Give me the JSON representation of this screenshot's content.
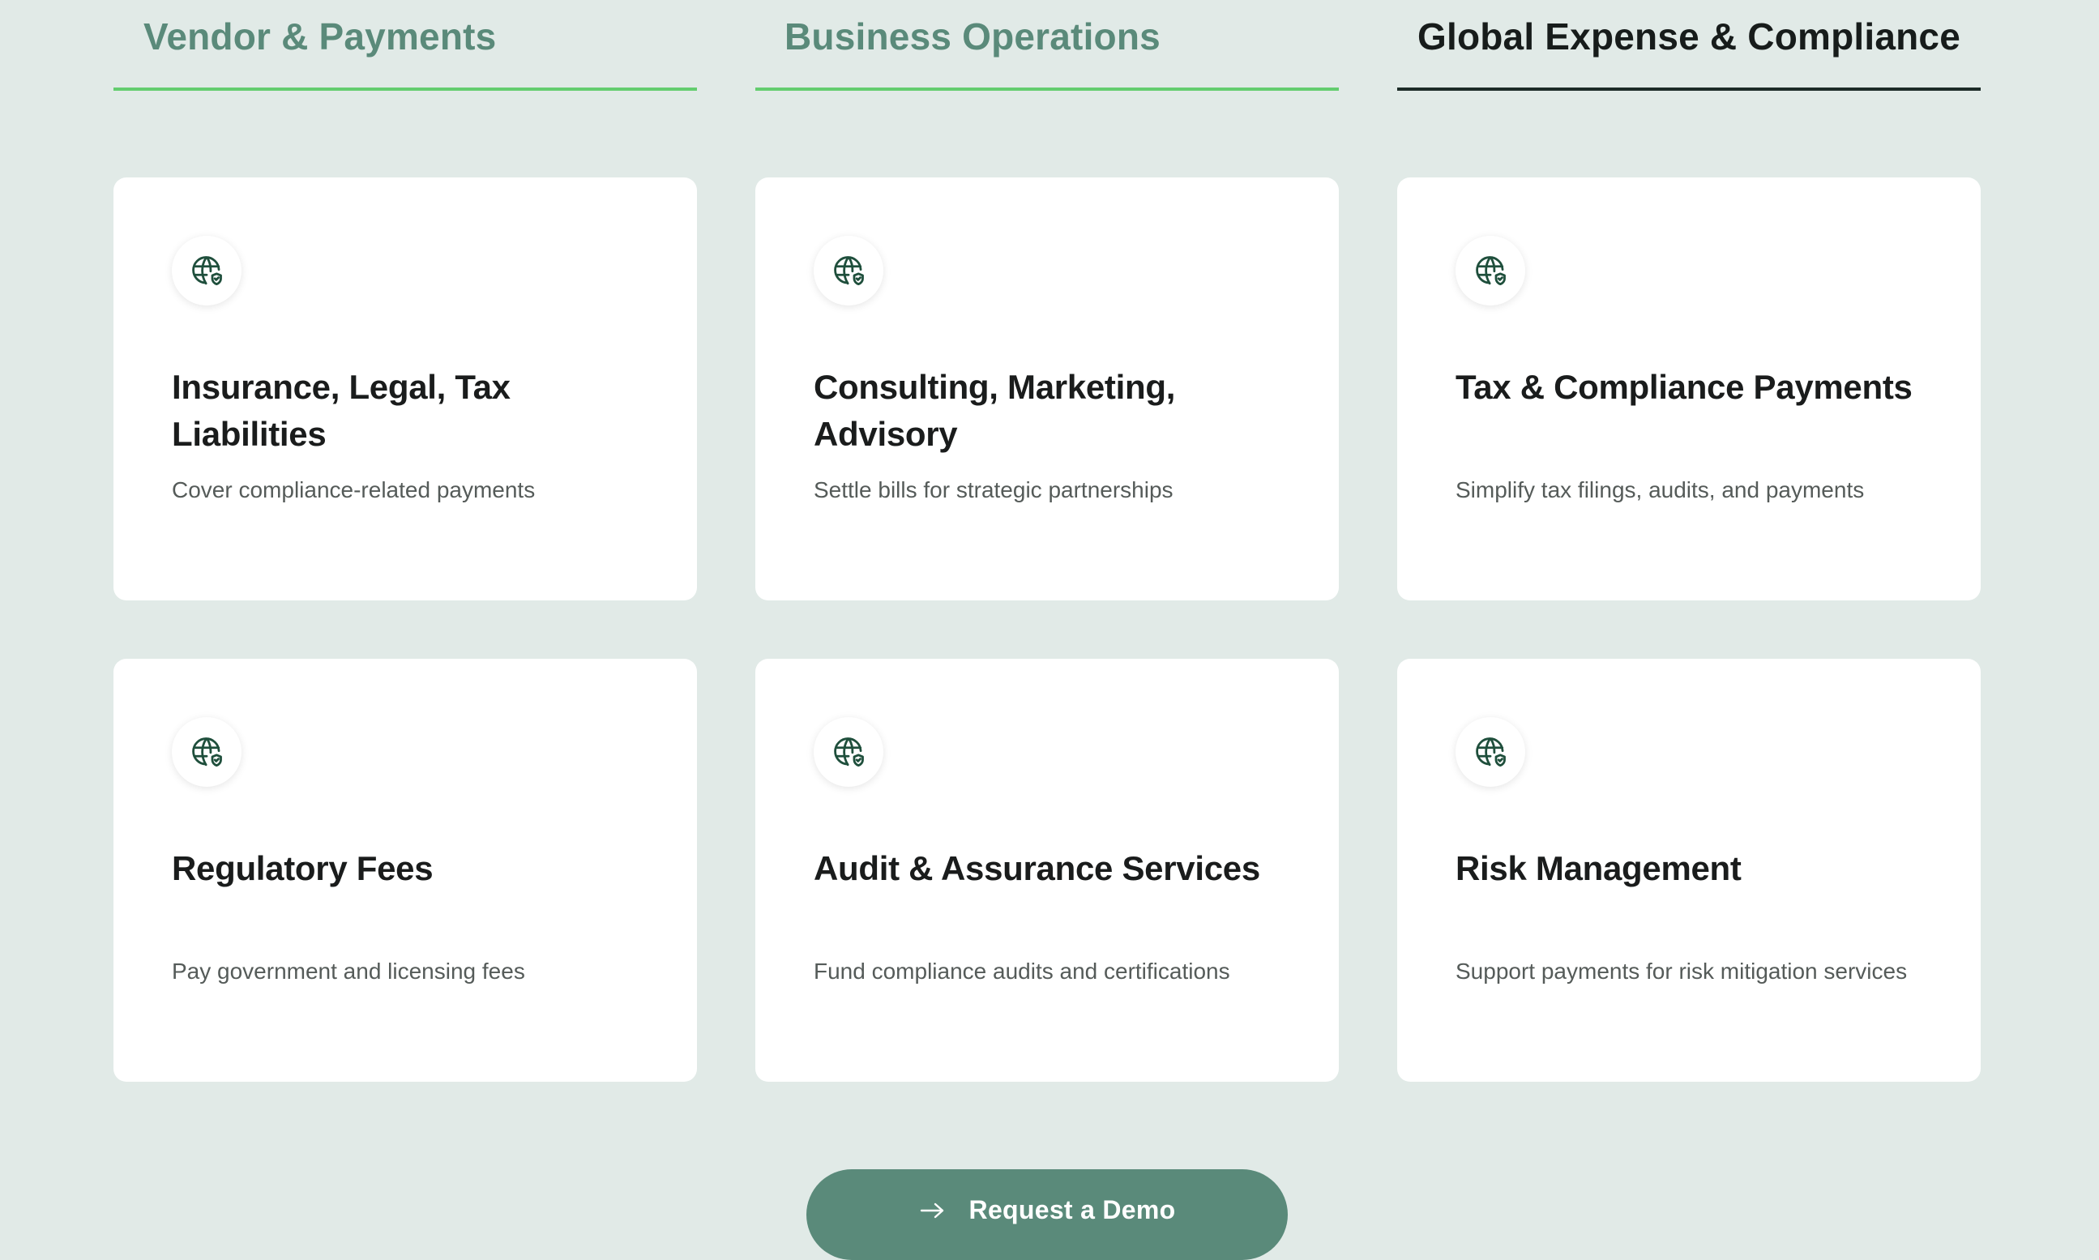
{
  "tabs": [
    {
      "label": "Vendor & Payments",
      "active": false
    },
    {
      "label": "Business Operations",
      "active": false
    },
    {
      "label": "Global Expense & Compliance",
      "active": true
    }
  ],
  "cards": [
    {
      "icon": "globe-shield-icon",
      "title": "Insurance, Legal, Tax Liabilities",
      "description": "Cover compliance-related payments"
    },
    {
      "icon": "globe-shield-icon",
      "title": "Consulting, Marketing, Advisory",
      "description": "Settle bills for strategic partnerships"
    },
    {
      "icon": "globe-shield-icon",
      "title": "Tax & Compliance Payments",
      "description": "Simplify tax filings, audits, and payments"
    },
    {
      "icon": "globe-shield-icon",
      "title": "Regulatory Fees",
      "description": "Pay government and licensing fees"
    },
    {
      "icon": "globe-shield-icon",
      "title": "Audit & Assurance Services",
      "description": "Fund compliance audits and certifications"
    },
    {
      "icon": "globe-shield-icon",
      "title": "Risk Management",
      "description": "Support payments for risk mitigation services"
    }
  ],
  "cta": {
    "label": "Request a Demo",
    "icon": "arrow-right-icon"
  },
  "colors": {
    "background": "#e1eae7",
    "accent_green": "#5a8a7a",
    "tab_underline": "#63cd6f",
    "tab_active_underline": "#1c2b27",
    "card_background": "#ffffff",
    "icon_color": "#1f4f3c"
  }
}
